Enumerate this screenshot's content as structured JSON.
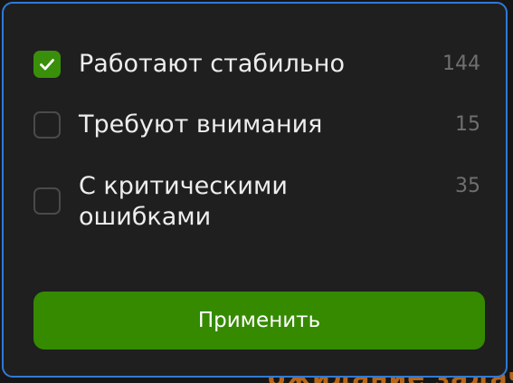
{
  "background": {
    "peek_text": "ожидание задач"
  },
  "filter": {
    "options": [
      {
        "label": "Работают стабильно",
        "count": "144",
        "checked": true
      },
      {
        "label": "Требуют внимания",
        "count": "15",
        "checked": false
      },
      {
        "label": "С критическими ошибками",
        "count": "35",
        "checked": false
      }
    ],
    "apply_label": "Применить"
  },
  "colors": {
    "accent_green": "#358a00",
    "checkbox_checked": "#3a8f0a",
    "focus_border": "#2f7ad6",
    "panel_bg": "#1f1f1f"
  },
  "icons": {
    "check": "check-icon"
  }
}
